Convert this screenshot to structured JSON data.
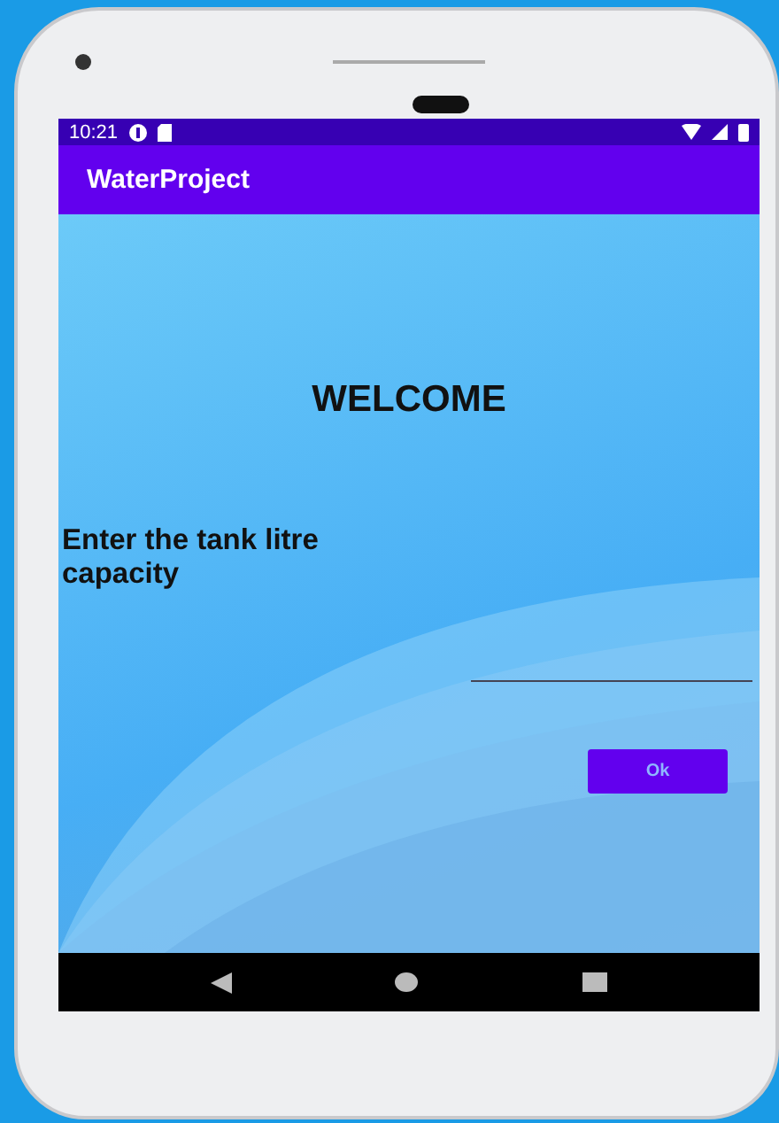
{
  "status_bar": {
    "time": "10:21"
  },
  "app_bar": {
    "title": "WaterProject"
  },
  "content": {
    "heading": "WELCOME",
    "prompt": "Enter the tank litre capacity",
    "button": {
      "label": "Ok"
    }
  }
}
